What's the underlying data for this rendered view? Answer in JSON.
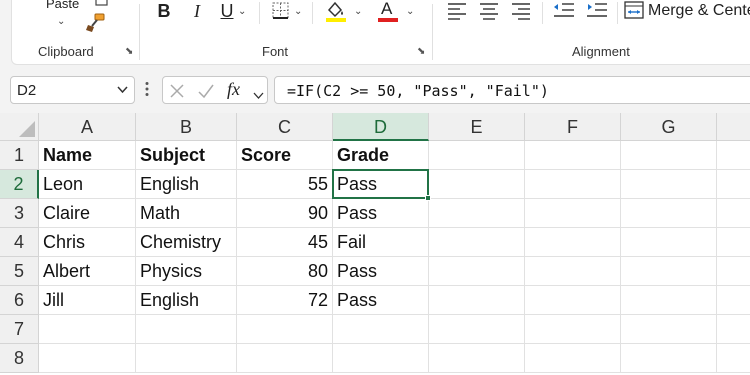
{
  "ribbon": {
    "clipboard": {
      "paste_label": "Paste",
      "group_label": "Clipboard"
    },
    "font": {
      "group_label": "Font",
      "bold": "B",
      "italic": "I",
      "underline": "U",
      "font_color_letter": "A",
      "fill_color": "#ffee00",
      "font_color": "#e02020"
    },
    "alignment": {
      "group_label": "Alignment",
      "merge_label": "Merge & Center"
    }
  },
  "formula_bar": {
    "name_box": "D2",
    "fx": "fx",
    "formula": "=IF(C2 >= 50, \"Pass\", \"Fail\")"
  },
  "sheet": {
    "columns": [
      "A",
      "B",
      "C",
      "D",
      "E",
      "F",
      "G"
    ],
    "rows": [
      "1",
      "2",
      "3",
      "4",
      "5",
      "6",
      "7",
      "8"
    ],
    "active_cell": "D2",
    "accent": "#217346",
    "data": [
      [
        "Name",
        "Subject",
        "Score",
        "Grade"
      ],
      [
        "Leon",
        "English",
        "55",
        "Pass"
      ],
      [
        "Claire",
        "Math",
        "90",
        "Pass"
      ],
      [
        "Chris",
        "Chemistry",
        "45",
        "Fail"
      ],
      [
        "Albert",
        "Physics",
        "80",
        "Pass"
      ],
      [
        "Jill",
        "English",
        "72",
        "Pass"
      ]
    ]
  }
}
